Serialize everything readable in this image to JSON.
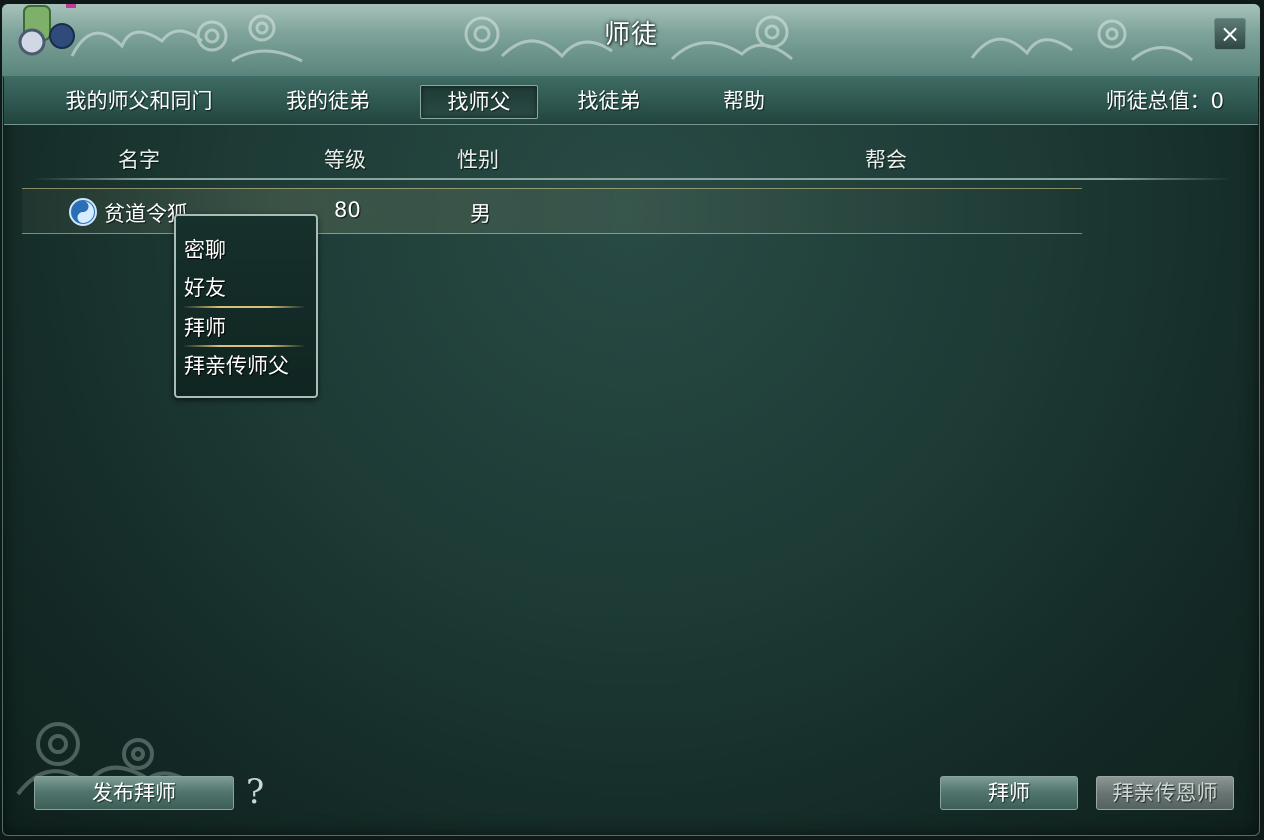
{
  "window": {
    "title": "师徒",
    "close_icon": "×"
  },
  "tabs": [
    {
      "label": "我的师父和同门"
    },
    {
      "label": "我的徒弟"
    },
    {
      "label": "找师父",
      "active": true
    },
    {
      "label": "找徒弟"
    },
    {
      "label": "帮助"
    }
  ],
  "total": {
    "label": "师徒总值：0"
  },
  "columns": {
    "name": "名字",
    "level": "等级",
    "gender": "性别",
    "guild": "帮会"
  },
  "rows": [
    {
      "name": "贫道令狐",
      "level": "80",
      "gender": "男",
      "guild": "",
      "icon": "faction-taiji-icon"
    }
  ],
  "context_menu": {
    "items": [
      "密聊",
      "好友",
      "拜师",
      "拜亲传师父"
    ]
  },
  "buttons": {
    "publish": "发布拜师",
    "help": "?",
    "apprentice": "拜师",
    "personal_master": "拜亲传恩师"
  },
  "colors": {
    "accent": "#2e5750",
    "highlight_line": "#d8c07a"
  }
}
